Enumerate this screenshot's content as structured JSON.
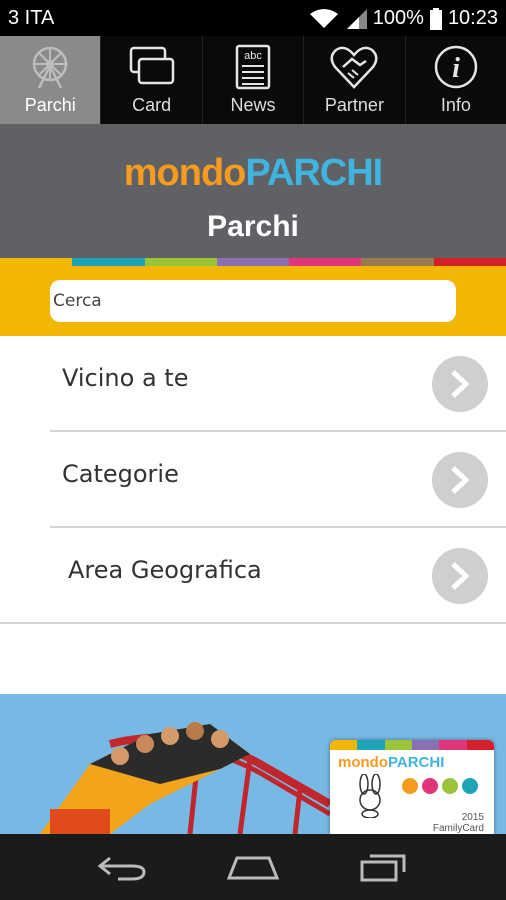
{
  "status_bar": {
    "carrier": "3 ITA",
    "battery": "100%",
    "time": "10:23"
  },
  "tabs": [
    {
      "label": "Parchi",
      "icon": "ferris-wheel-icon",
      "active": true
    },
    {
      "label": "Card",
      "icon": "cards-icon",
      "active": false
    },
    {
      "label": "News",
      "icon": "newspaper-icon",
      "active": false
    },
    {
      "label": "Partner",
      "icon": "handshake-heart-icon",
      "active": false
    },
    {
      "label": "Info",
      "icon": "info-icon",
      "active": false
    }
  ],
  "header": {
    "logo_mondo": "mondo",
    "logo_parchi": "PARCHI",
    "title": "Parchi"
  },
  "stripe_colors": [
    "#f2b705",
    "#1fa3b8",
    "#9bc43a",
    "#8b6fb3",
    "#e0357a",
    "#9a7b4f",
    "#d3202b"
  ],
  "search": {
    "placeholder": "Cerca",
    "value": ""
  },
  "menu": [
    {
      "label": "Vicino a te"
    },
    {
      "label": "Categorie"
    },
    {
      "label": "Area Geografica"
    }
  ],
  "banner": {
    "card_logo_mondo": "mondo",
    "card_logo_parchi": "PARCHI",
    "card_year": "2015",
    "card_type": "FamilyCard"
  },
  "colors": {
    "tab_active": "#8a8a8a",
    "header_bg": "#5f6164",
    "search_bar": "#f2b705",
    "logo_orange": "#f59b1f",
    "logo_blue": "#3fb4e0"
  }
}
